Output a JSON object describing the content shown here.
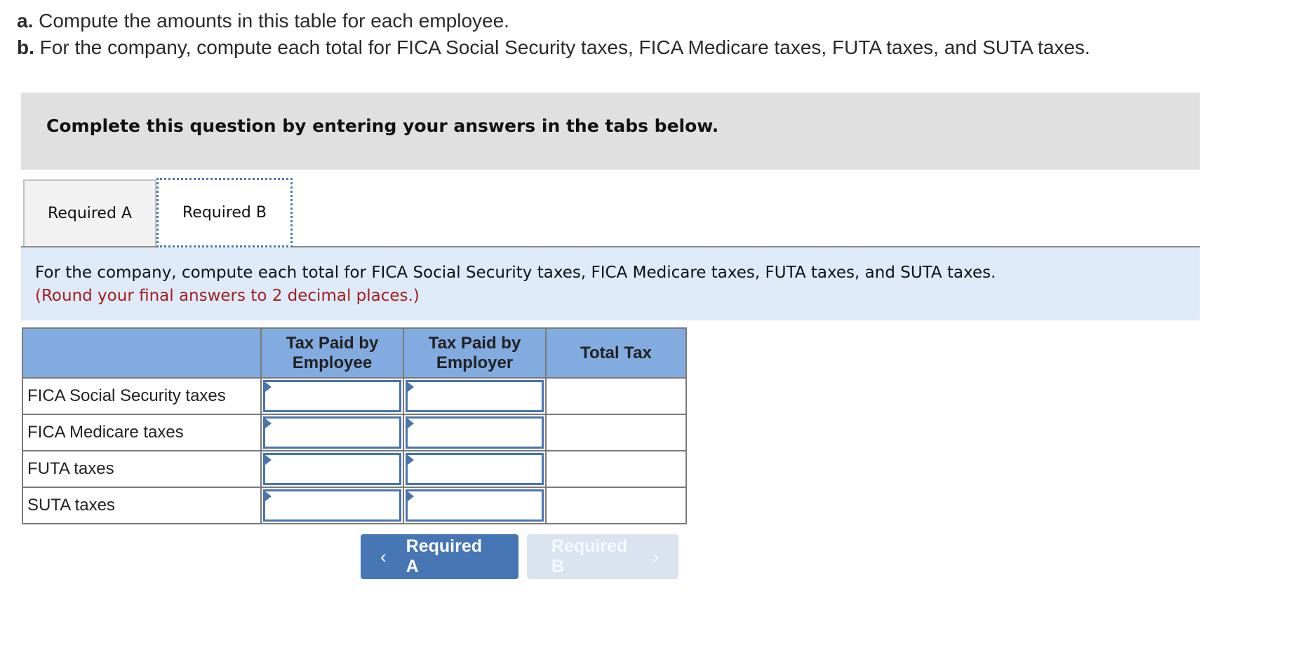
{
  "prompt": {
    "a_marker": "a.",
    "a_text": " Compute the amounts in this table for each employee.",
    "b_marker": "b.",
    "b_text": " For the company, compute each total for FICA Social Security taxes, FICA Medicare taxes, FUTA taxes, and SUTA taxes."
  },
  "instruction_banner": "Complete this question by entering your answers in the tabs below.",
  "tabs": [
    {
      "label": "Required A",
      "active": false
    },
    {
      "label": "Required B",
      "active": true
    }
  ],
  "question": {
    "text": "For the company, compute each total for FICA Social Security taxes, FICA Medicare taxes, FUTA taxes, and SUTA taxes.",
    "note": "(Round your final answers to 2 decimal places.)"
  },
  "table": {
    "headers": [
      "",
      "Tax Paid by\nEmployee",
      "Tax Paid by\nEmployer",
      "Total Tax"
    ],
    "header_lines": {
      "employee": [
        "Tax Paid by",
        "Employee"
      ],
      "employer": [
        "Tax Paid by",
        "Employer"
      ],
      "total": "Total Tax"
    },
    "rows": [
      {
        "label": "FICA Social Security taxes",
        "employee": "",
        "employer": "",
        "total": ""
      },
      {
        "label": "FICA Medicare taxes",
        "employee": "",
        "employer": "",
        "total": ""
      },
      {
        "label": "FUTA taxes",
        "employee": "",
        "employer": "",
        "total": ""
      },
      {
        "label": "SUTA taxes",
        "employee": "",
        "employer": "",
        "total": ""
      }
    ]
  },
  "nav": {
    "prev_label": "Required A",
    "prev_icon": "chevron-left-icon",
    "next_label": "Required B",
    "next_icon": "chevron-right-icon",
    "next_disabled": true
  },
  "colors": {
    "header_blue": "#82abdf",
    "input_border": "#4a74ad",
    "primary_button": "#4776b4",
    "disabled_button": "#dae3ef",
    "note_red": "#a11f1f",
    "banner_gray": "#e0e0e0",
    "question_bg": "#deeaf7"
  }
}
